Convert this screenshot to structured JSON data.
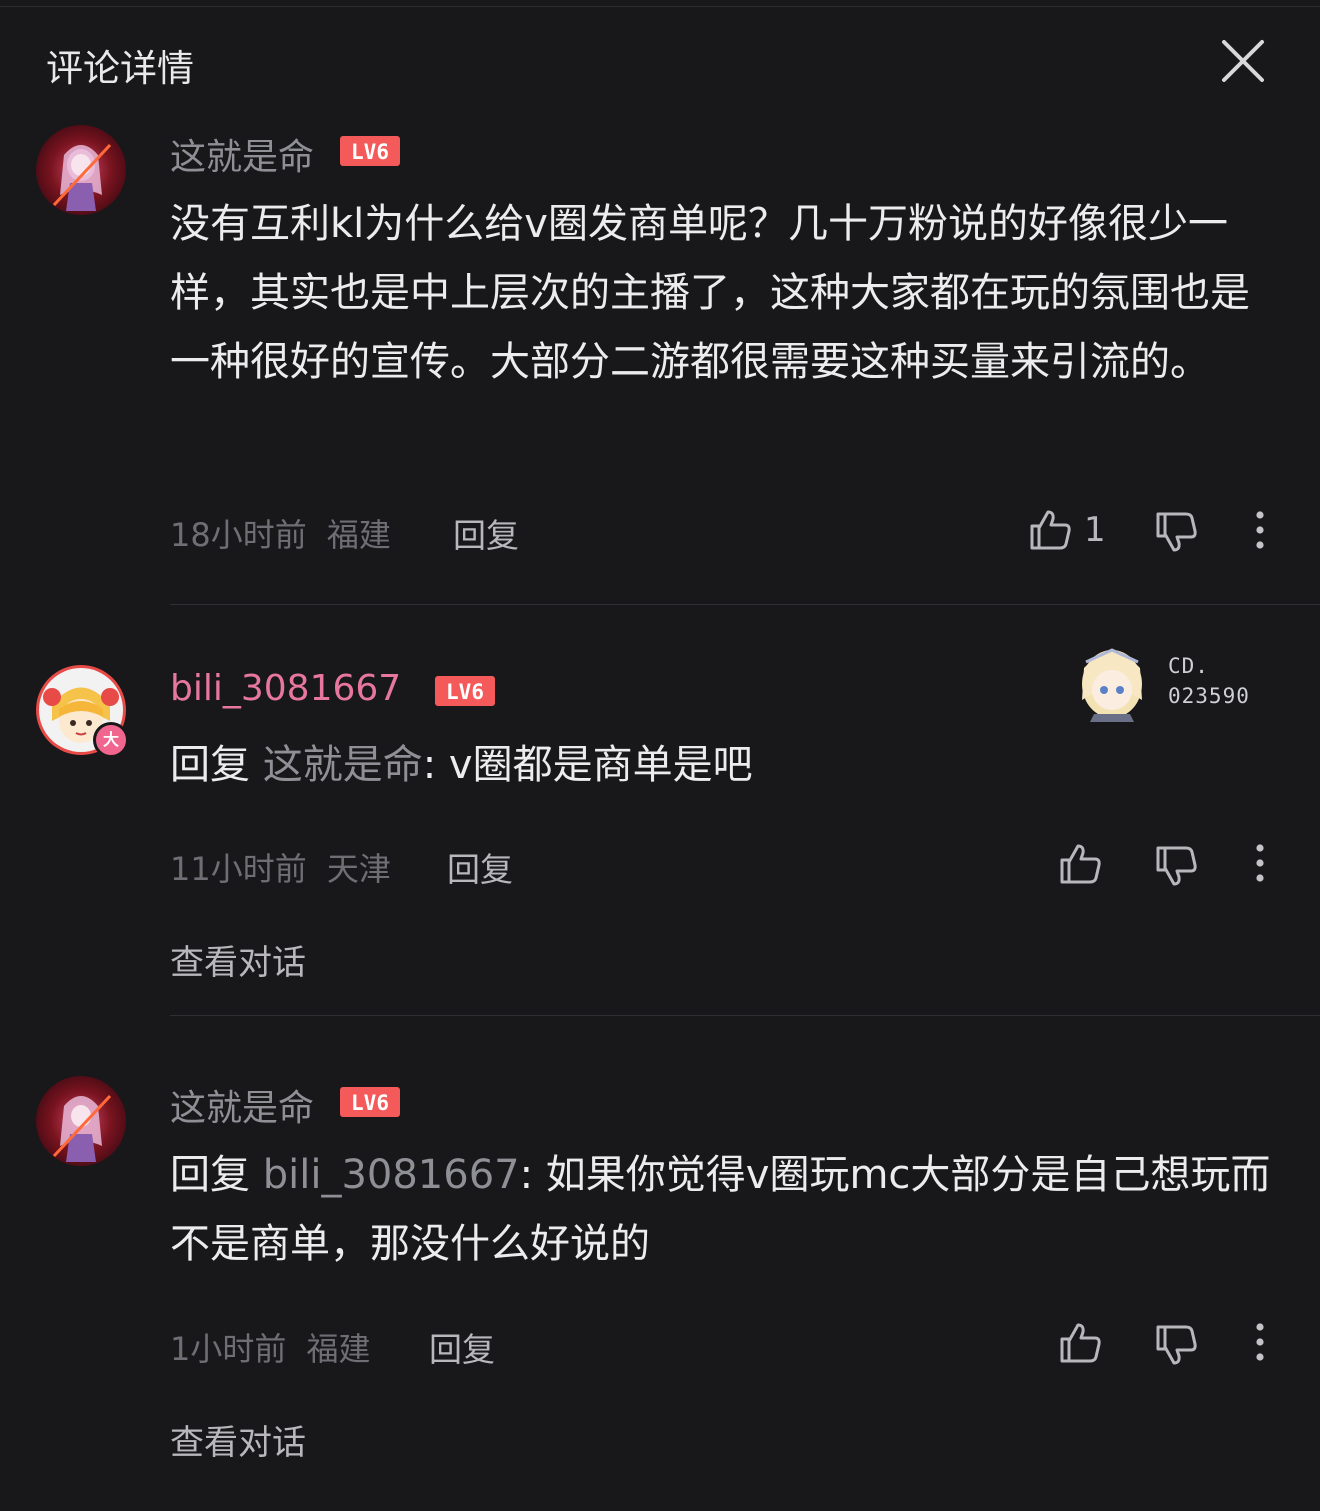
{
  "header": {
    "title": "评论详情"
  },
  "comments": [
    {
      "username": "这就是命",
      "level": "LV6",
      "content": "没有互利kl为什么给v圈发商单呢？几十万粉说的好像很少一样，其实也是中上层次的主播了，这种大家都在玩的氛围也是一种很好的宣传。大部分二游都很需要这种买量来引流的。",
      "time": "18小时前",
      "location": "福建",
      "reply_label": "回复",
      "like_count": "1"
    },
    {
      "username": "bili_3081667",
      "level": "LV6",
      "avatar_badge": "大",
      "reply_prefix": "回复",
      "reply_to": "这就是命",
      "content": ": v圈都是商单是吧",
      "time": "11小时前",
      "location": "天津",
      "reply_label": "回复",
      "view_conversation": "查看对话",
      "fan_badge": {
        "line1": "CD.",
        "line2": "023590"
      }
    },
    {
      "username": "这就是命",
      "level": "LV6",
      "reply_prefix": "回复",
      "reply_to": "bili_3081667",
      "content": ": 如果你觉得v圈玩mc大部分是自己想玩而不是商单，那没什么好说的",
      "time": "1小时前",
      "location": "福建",
      "reply_label": "回复",
      "view_conversation": "查看对话"
    }
  ],
  "colors": {
    "background": "#18181a",
    "level_badge": "#f45a5a",
    "vip_name": "#e7779e"
  }
}
